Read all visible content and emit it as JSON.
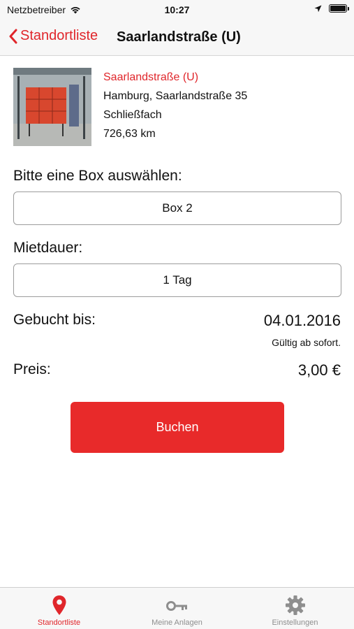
{
  "status_bar": {
    "carrier": "Netzbetreiber",
    "time": "10:27"
  },
  "nav": {
    "back_label": "Standortliste",
    "title": "Saarlandstraße (U)"
  },
  "location": {
    "name": "Saarlandstraße (U)",
    "address": "Hamburg, Saarlandstraße 35",
    "type": "Schließfach",
    "distance": "726,63 km"
  },
  "form": {
    "box_label": "Bitte eine Box auswählen:",
    "box_value": "Box 2",
    "duration_label": "Mietdauer:",
    "duration_value": "1 Tag",
    "booked_until_label": "Gebucht bis:",
    "booked_until_value": "04.01.2016",
    "valid_hint": "Gültig ab sofort.",
    "price_label": "Preis:",
    "price_value": "3,00 €",
    "book_button": "Buchen"
  },
  "tabs": [
    {
      "label": "Standortliste",
      "icon": "map-pin-icon",
      "active": true
    },
    {
      "label": "Meine Anlagen",
      "icon": "key-icon",
      "active": false
    },
    {
      "label": "Einstellungen",
      "icon": "gear-icon",
      "active": false
    }
  ],
  "colors": {
    "accent": "#e0262b",
    "button": "#e82a2a",
    "inactive": "#8e8e8e"
  }
}
